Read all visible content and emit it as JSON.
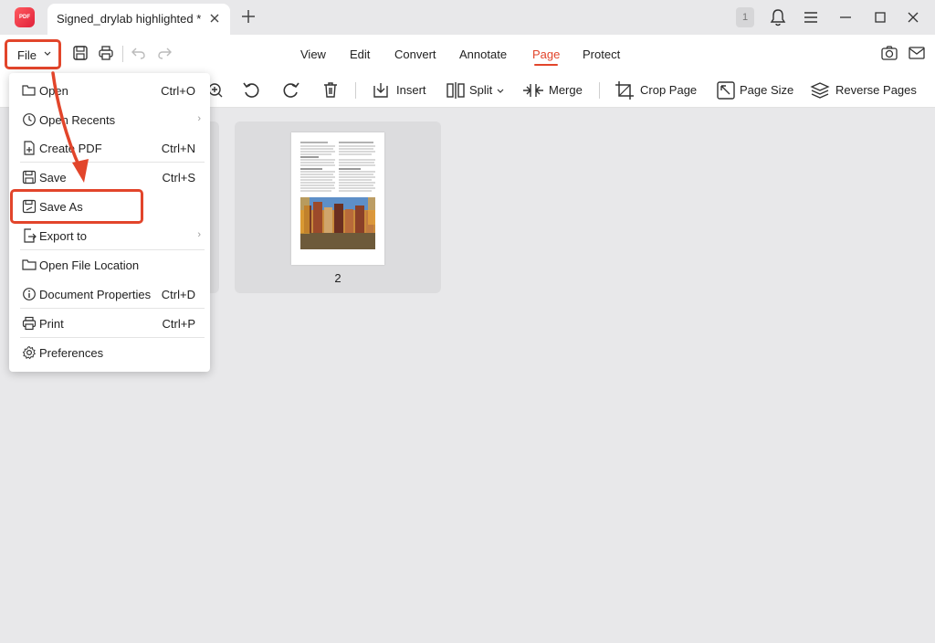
{
  "app": {
    "logo_text": "PDF"
  },
  "tab": {
    "title": "Signed_drylab highlighted *"
  },
  "notifications": {
    "count": "1"
  },
  "menubar": {
    "file_label": "File",
    "nav": [
      "View",
      "Edit",
      "Convert",
      "Annotate",
      "Page",
      "Protect"
    ],
    "active": "Page"
  },
  "toolbar": {
    "insert": "Insert",
    "split": "Split",
    "merge": "Merge",
    "crop": "Crop Page",
    "page_size": "Page Size",
    "reverse": "Reverse Pages"
  },
  "pages": [
    {
      "number": "2"
    }
  ],
  "file_menu": {
    "items": [
      {
        "label": "Open",
        "shortcut": "Ctrl+O"
      },
      {
        "label": "Open Recents",
        "submenu": true
      },
      {
        "label": "Create PDF",
        "shortcut": "Ctrl+N"
      },
      {
        "label": "Save",
        "shortcut": "Ctrl+S"
      },
      {
        "label": "Save As",
        "shortcut": ""
      },
      {
        "label": "Export to",
        "submenu": true
      },
      {
        "label": "Open File Location",
        "shortcut": ""
      },
      {
        "label": "Document Properties",
        "shortcut": "Ctrl+D"
      },
      {
        "label": "Print",
        "shortcut": "Ctrl+P"
      },
      {
        "label": "Preferences",
        "shortcut": ""
      }
    ],
    "submenu_glyph": "›"
  },
  "colors": {
    "accent": "#e2452b",
    "background": "#e8e8ea"
  }
}
